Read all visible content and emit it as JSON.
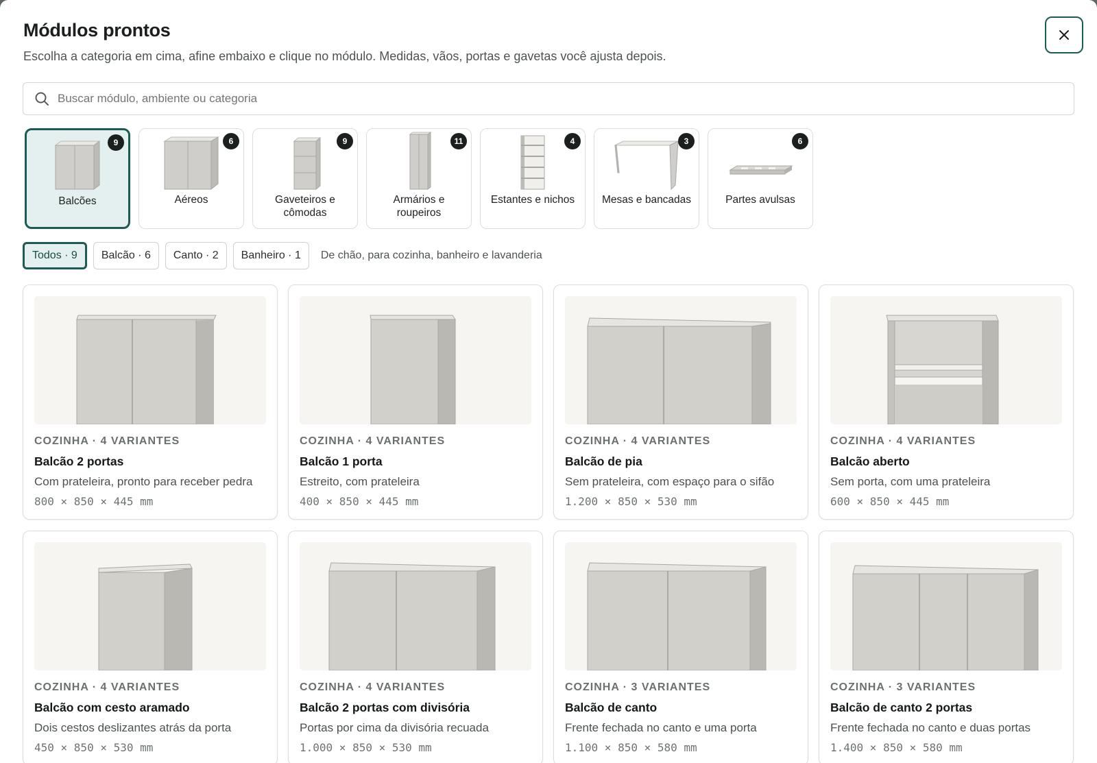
{
  "header": {
    "title": "Módulos prontos",
    "subtitle": "Escolha a categoria em cima, afine embaixo e clique no módulo. Medidas, vãos, portas e gavetas você ajusta depois.",
    "close_icon": "close-icon"
  },
  "search": {
    "placeholder": "Buscar módulo, ambiente ou categoria",
    "value": "",
    "icon": "search-icon"
  },
  "categories": [
    {
      "label": "Balcões",
      "count": "9",
      "active": true
    },
    {
      "label": "Aéreos",
      "count": "6",
      "active": false
    },
    {
      "label": "Gaveteiros e cômodas",
      "count": "9",
      "active": false
    },
    {
      "label": "Armários e roupeiros",
      "count": "11",
      "active": false
    },
    {
      "label": "Estantes e nichos",
      "count": "4",
      "active": false
    },
    {
      "label": "Mesas e bancadas",
      "count": "3",
      "active": false
    },
    {
      "label": "Partes avulsas",
      "count": "6",
      "active": false
    }
  ],
  "filters": {
    "chips": [
      {
        "label": "Todos · 9",
        "active": true
      },
      {
        "label": "Balcão · 6",
        "active": false
      },
      {
        "label": "Canto · 2",
        "active": false
      },
      {
        "label": "Banheiro · 1",
        "active": false
      }
    ],
    "description": "De chão, para cozinha, banheiro e lavanderia"
  },
  "modules": [
    {
      "meta": "COZINHA · 4 VARIANTES",
      "name": "Balcão 2 portas",
      "desc": "Com prateleira, pronto para receber pedra",
      "dims": "800 × 850 × 445 mm"
    },
    {
      "meta": "COZINHA · 4 VARIANTES",
      "name": "Balcão 1 porta",
      "desc": "Estreito, com prateleira",
      "dims": "400 × 850 × 445 mm"
    },
    {
      "meta": "COZINHA · 4 VARIANTES",
      "name": "Balcão de pia",
      "desc": "Sem prateleira, com espaço para o sifão",
      "dims": "1.200 × 850 × 530 mm"
    },
    {
      "meta": "COZINHA · 4 VARIANTES",
      "name": "Balcão aberto",
      "desc": "Sem porta, com uma prateleira",
      "dims": "600 × 850 × 445 mm"
    },
    {
      "meta": "COZINHA · 4 VARIANTES",
      "name": "Balcão com cesto aramado",
      "desc": "Dois cestos deslizantes atrás da porta",
      "dims": "450 × 850 × 530 mm"
    },
    {
      "meta": "COZINHA · 4 VARIANTES",
      "name": "Balcão 2 portas com divisória",
      "desc": "Portas por cima da divisória recuada",
      "dims": "1.000 × 850 × 530 mm"
    },
    {
      "meta": "COZINHA · 3 VARIANTES",
      "name": "Balcão de canto",
      "desc": "Frente fechada no canto e uma porta",
      "dims": "1.100 × 850 × 580 mm"
    },
    {
      "meta": "COZINHA · 3 VARIANTES",
      "name": "Balcão de canto 2 portas",
      "desc": "Frente fechada no canto e duas portas",
      "dims": "1.400 × 850 × 580 mm"
    }
  ],
  "colors": {
    "accent": "#1b5b55",
    "accent_bg": "#e3f0ef"
  }
}
